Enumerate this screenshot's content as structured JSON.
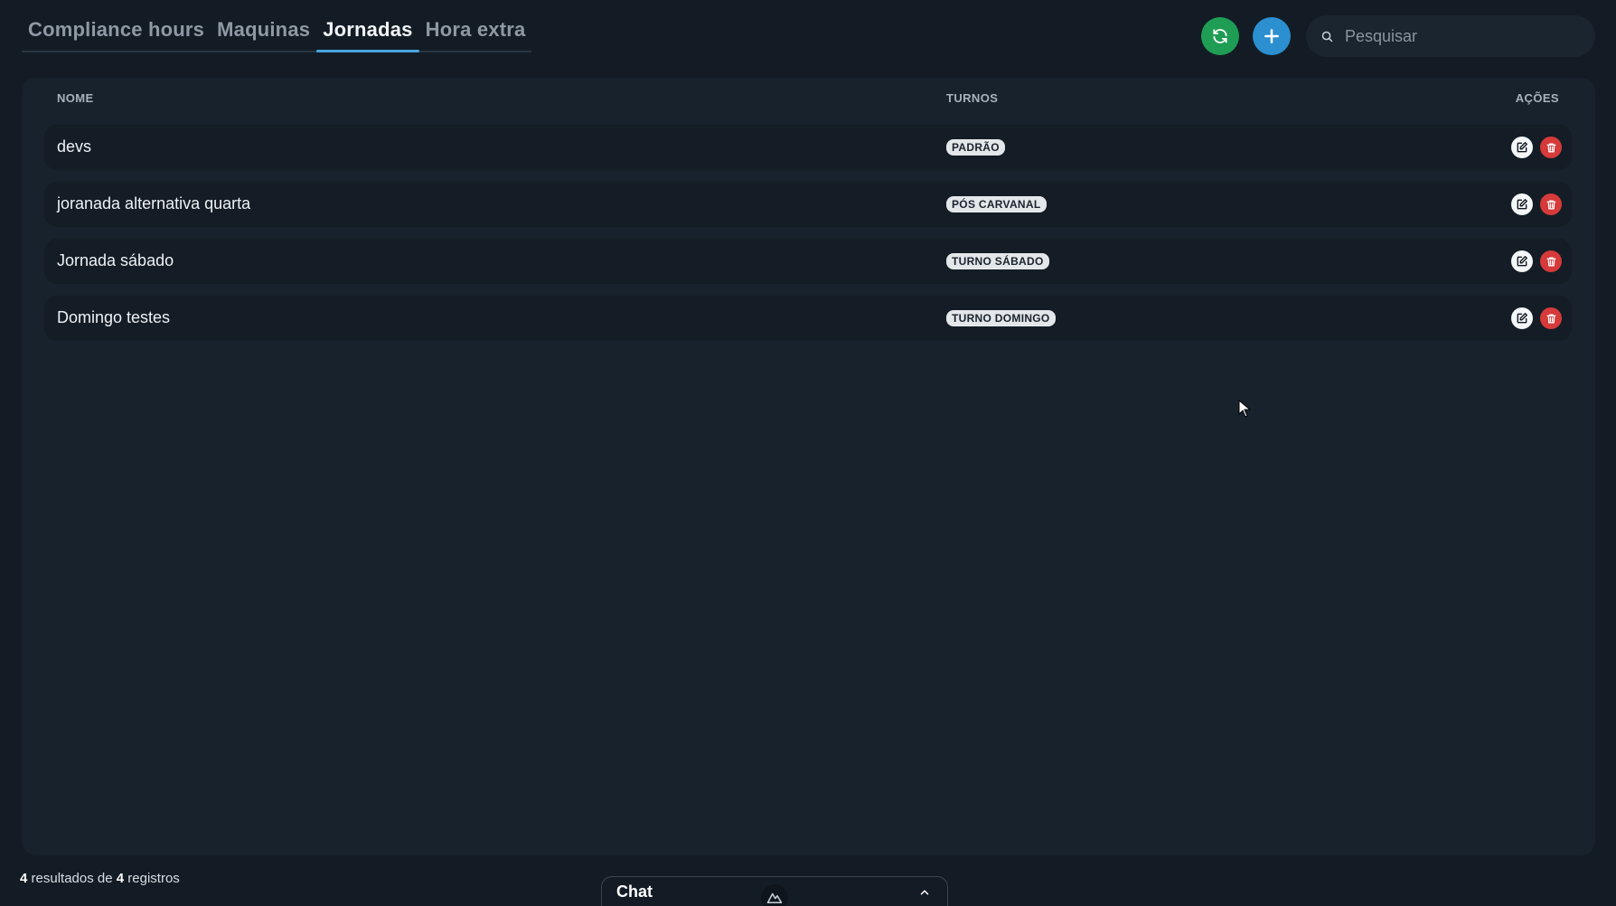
{
  "tabs": [
    {
      "label": "Compliance hours",
      "active": false
    },
    {
      "label": "Maquinas",
      "active": false
    },
    {
      "label": "Jornadas",
      "active": true
    },
    {
      "label": "Hora extra",
      "active": false
    }
  ],
  "toolbar": {
    "refresh_icon": "refresh-icon",
    "add_icon": "plus-icon"
  },
  "search": {
    "placeholder": "Pesquisar",
    "value": ""
  },
  "table": {
    "headers": {
      "name": "NOME",
      "turnos": "TURNOS",
      "acoes": "AÇÕES"
    },
    "rows": [
      {
        "name": "devs",
        "turno": "PADRÃO"
      },
      {
        "name": "joranada alternativa quarta",
        "turno": "PÓS CARVANAL"
      },
      {
        "name": "Jornada sábado",
        "turno": "TURNO SÁBADO"
      },
      {
        "name": "Domingo testes",
        "turno": "TURNO DOMINGO"
      }
    ]
  },
  "footer": {
    "count_shown": "4",
    "text_mid": "resultados de",
    "count_total": "4",
    "text_end": "registros"
  },
  "chat": {
    "label": "Chat"
  },
  "colors": {
    "background": "#131c25",
    "card": "#18222c",
    "row": "#141d26",
    "accent_blue": "#2b8fd0",
    "accent_green": "#1f9d55",
    "delete_red": "#d63a3a"
  }
}
